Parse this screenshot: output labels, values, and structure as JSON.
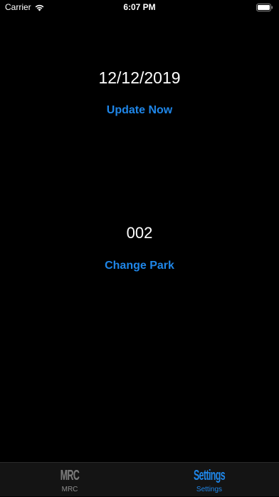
{
  "status_bar": {
    "carrier": "Carrier",
    "time": "6:07 PM",
    "wifi_icon": "wifi-icon",
    "battery_icon": "battery-icon"
  },
  "main": {
    "date": "12/12/2019",
    "update_button_label": "Update Now",
    "park_number": "002",
    "change_park_label": "Change Park"
  },
  "tab_bar": {
    "tabs": [
      {
        "icon_text": "MRC",
        "label": "MRC",
        "selected": false
      },
      {
        "icon_text": "Settings",
        "label": "Settings",
        "selected": true
      }
    ]
  },
  "colors": {
    "background": "#000000",
    "accent": "#1f86e8",
    "tab_inactive": "#8e8e8e",
    "tab_bar_bg": "#141414"
  }
}
